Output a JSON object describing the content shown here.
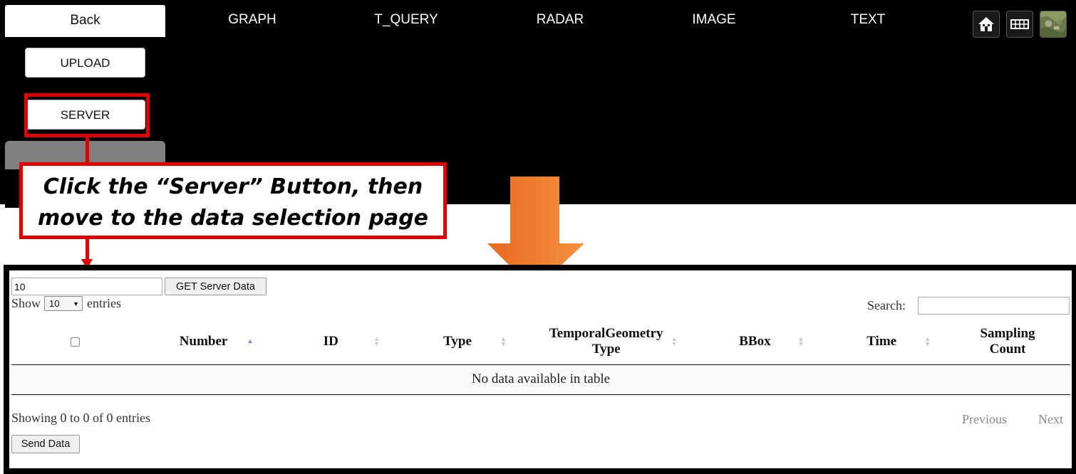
{
  "top_app": {
    "tabs": [
      "Back",
      "GRAPH",
      "T_QUERY",
      "RADAR",
      "IMAGE",
      "TEXT"
    ],
    "side_buttons": {
      "upload": "UPLOAD",
      "server": "SERVER"
    },
    "icons": [
      "home-icon",
      "grid-icon",
      "map-thumbnail-icon"
    ]
  },
  "annotation": {
    "line1": "Click the “Server” Button, then",
    "line2": "move to the data selection page",
    "highlight_color": "#e00000",
    "arrow_color": "#ef7e2f"
  },
  "data_page": {
    "count_input_value": "10",
    "get_server_button": "GET Server Data",
    "show_label": "Show",
    "entries_select_value": "10",
    "entries_label": "entries",
    "search_label": "Search:",
    "search_value": "",
    "table": {
      "columns": [
        "",
        "Number",
        "ID",
        "Type",
        "TemporalGeometry Type",
        "BBox",
        "Time",
        "Sampling Count"
      ],
      "empty_message": "No data available in table"
    },
    "info": "Showing 0 to 0 of 0 entries",
    "pagination": {
      "previous": "Previous",
      "next": "Next"
    },
    "send_button": "Send Data"
  }
}
